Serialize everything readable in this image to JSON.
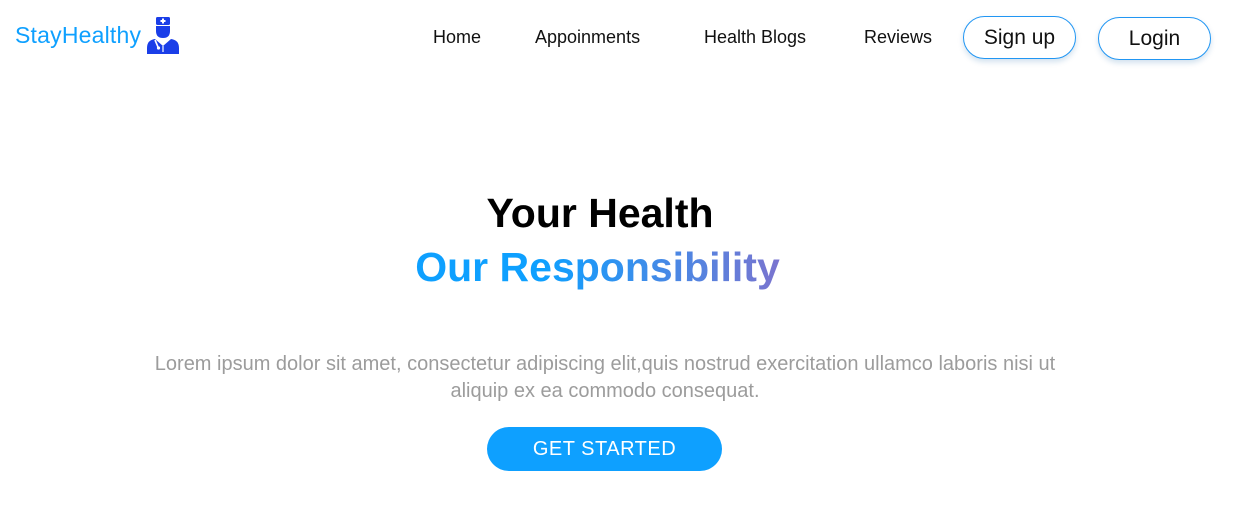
{
  "brand": {
    "name": "StayHealthy",
    "icon": "doctor-icon",
    "color": "#0ea0ff"
  },
  "nav": {
    "links": [
      "Home",
      "Appoinments",
      "Health Blogs",
      "Reviews"
    ],
    "signup_label": "Sign up",
    "login_label": "Login"
  },
  "hero": {
    "title": "Your Health",
    "subtitle": "Our Responsibility",
    "description": "Lorem ipsum dolor sit amet, consectetur adipiscing elit,quis nostrud exercitation ullamco laboris nisi ut aliquip ex ea commodo consequat.",
    "cta_label": "GET STARTED"
  },
  "colors": {
    "accent": "#0ea0ff",
    "gradient_end": "#7a74cf",
    "body_text": "#9c9c9c",
    "button_border": "#2196f3"
  }
}
